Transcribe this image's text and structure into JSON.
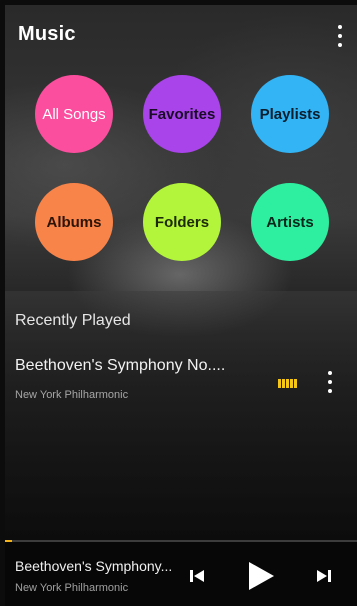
{
  "header": {
    "title": "Music",
    "menu_icon": "more-vertical-icon"
  },
  "categories": [
    {
      "label": "All Songs",
      "color": "#fb4e9e"
    },
    {
      "label": "Favorites",
      "color": "#a844ea"
    },
    {
      "label": "Playlists",
      "color": "#33b4f4"
    },
    {
      "label": "Albums",
      "color": "#f9844a"
    },
    {
      "label": "Folders",
      "color": "#b3f53b"
    },
    {
      "label": "Artists",
      "color": "#2eefa0"
    }
  ],
  "recently_played": {
    "title": "Recently Played",
    "items": [
      {
        "title": "Beethoven's Symphony No....",
        "artist": "New York Philharmonic",
        "now_playing_indicator": "equalizer-icon",
        "indicator_color": "#f5c518",
        "menu_icon": "more-vertical-icon"
      }
    ]
  },
  "player": {
    "title": "Beethoven's Symphony...",
    "artist": "New York Philharmonic",
    "progress": 0.02,
    "progress_color": "#f5b31b",
    "controls": [
      "skip-previous-icon",
      "play-icon",
      "skip-next-icon"
    ]
  }
}
